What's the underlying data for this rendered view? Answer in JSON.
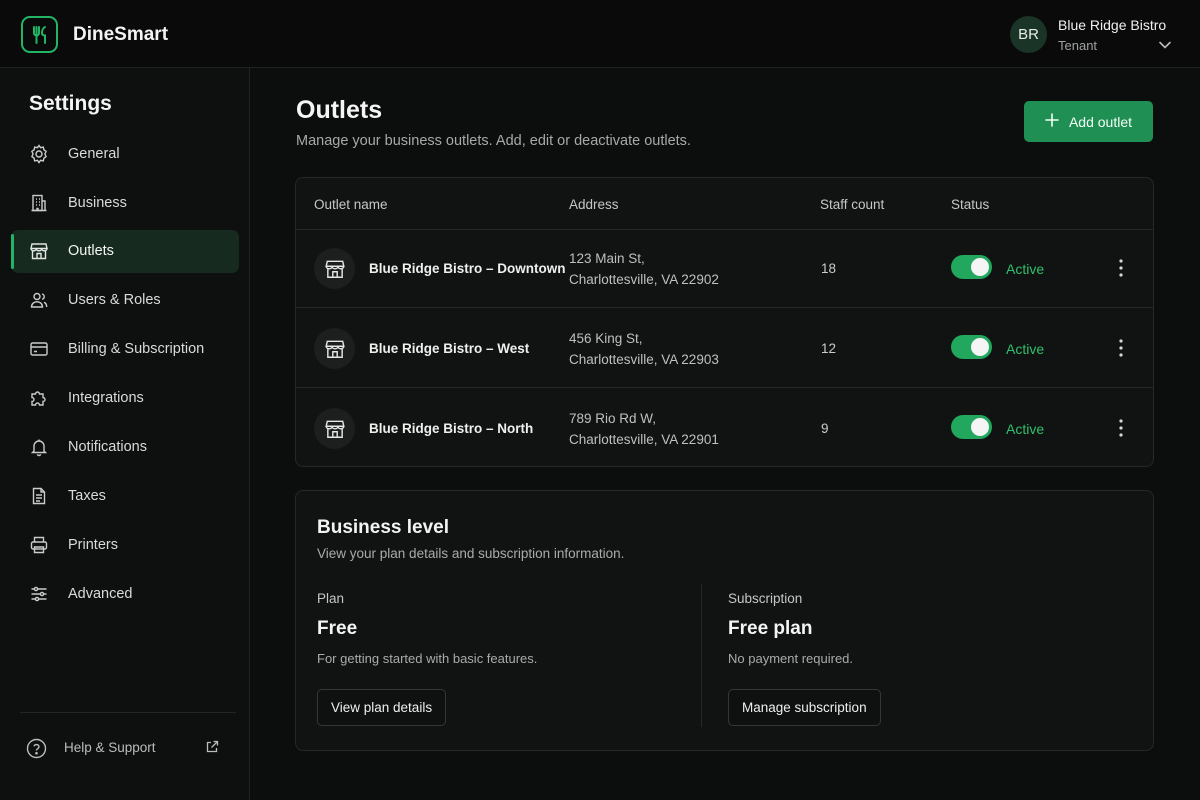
{
  "app": {
    "name": "DineSmart",
    "accent": "#22b565"
  },
  "user": {
    "initials": "BR",
    "name": "Blue Ridge Bistro",
    "role": "Tenant"
  },
  "sidebar": {
    "title": "Settings",
    "items": [
      {
        "label": "General",
        "icon": "gear-icon"
      },
      {
        "label": "Business",
        "icon": "building-icon"
      },
      {
        "label": "Outlets",
        "icon": "storefront-icon",
        "active": true
      },
      {
        "label": "Users & Roles",
        "icon": "users-icon"
      },
      {
        "label": "Billing & Subscription",
        "icon": "credit-card-icon"
      },
      {
        "label": "Integrations",
        "icon": "puzzle-icon"
      },
      {
        "label": "Notifications",
        "icon": "bell-icon"
      },
      {
        "label": "Taxes",
        "icon": "document-icon"
      },
      {
        "label": "Printers",
        "icon": "printer-icon"
      },
      {
        "label": "Advanced",
        "icon": "sliders-icon"
      }
    ],
    "help": {
      "label": "Help & Support"
    }
  },
  "page": {
    "title": "Outlets",
    "subtitle": "Manage your business outlets. Add, edit or deactivate outlets.",
    "add_button": "Add outlet"
  },
  "table": {
    "headers": [
      "Outlet name",
      "Address",
      "Staff count",
      "Status"
    ],
    "rows": [
      {
        "name": "Blue Ridge Bistro – Downtown",
        "address_line1": "123 Main St,",
        "address_line2": "Charlottesville, VA 22902",
        "staff": "18",
        "status": "Active",
        "enabled": true
      },
      {
        "name": "Blue Ridge Bistro – West",
        "address_line1": "456 King St,",
        "address_line2": "Charlottesville, VA 22903",
        "staff": "12",
        "status": "Active",
        "enabled": true
      },
      {
        "name": "Blue Ridge Bistro – North",
        "address_line1": "789 Rio Rd W,",
        "address_line2": "Charlottesville, VA 22901",
        "staff": "9",
        "status": "Active",
        "enabled": true
      }
    ]
  },
  "business": {
    "title": "Business level",
    "subtitle": "View your plan details and subscription information.",
    "plan": {
      "label": "Plan",
      "value": "Free",
      "description": "For getting started with basic features.",
      "button": "View plan details"
    },
    "subscription": {
      "label": "Subscription",
      "value": "Free plan",
      "description": "No payment required.",
      "button": "Manage subscription"
    }
  }
}
